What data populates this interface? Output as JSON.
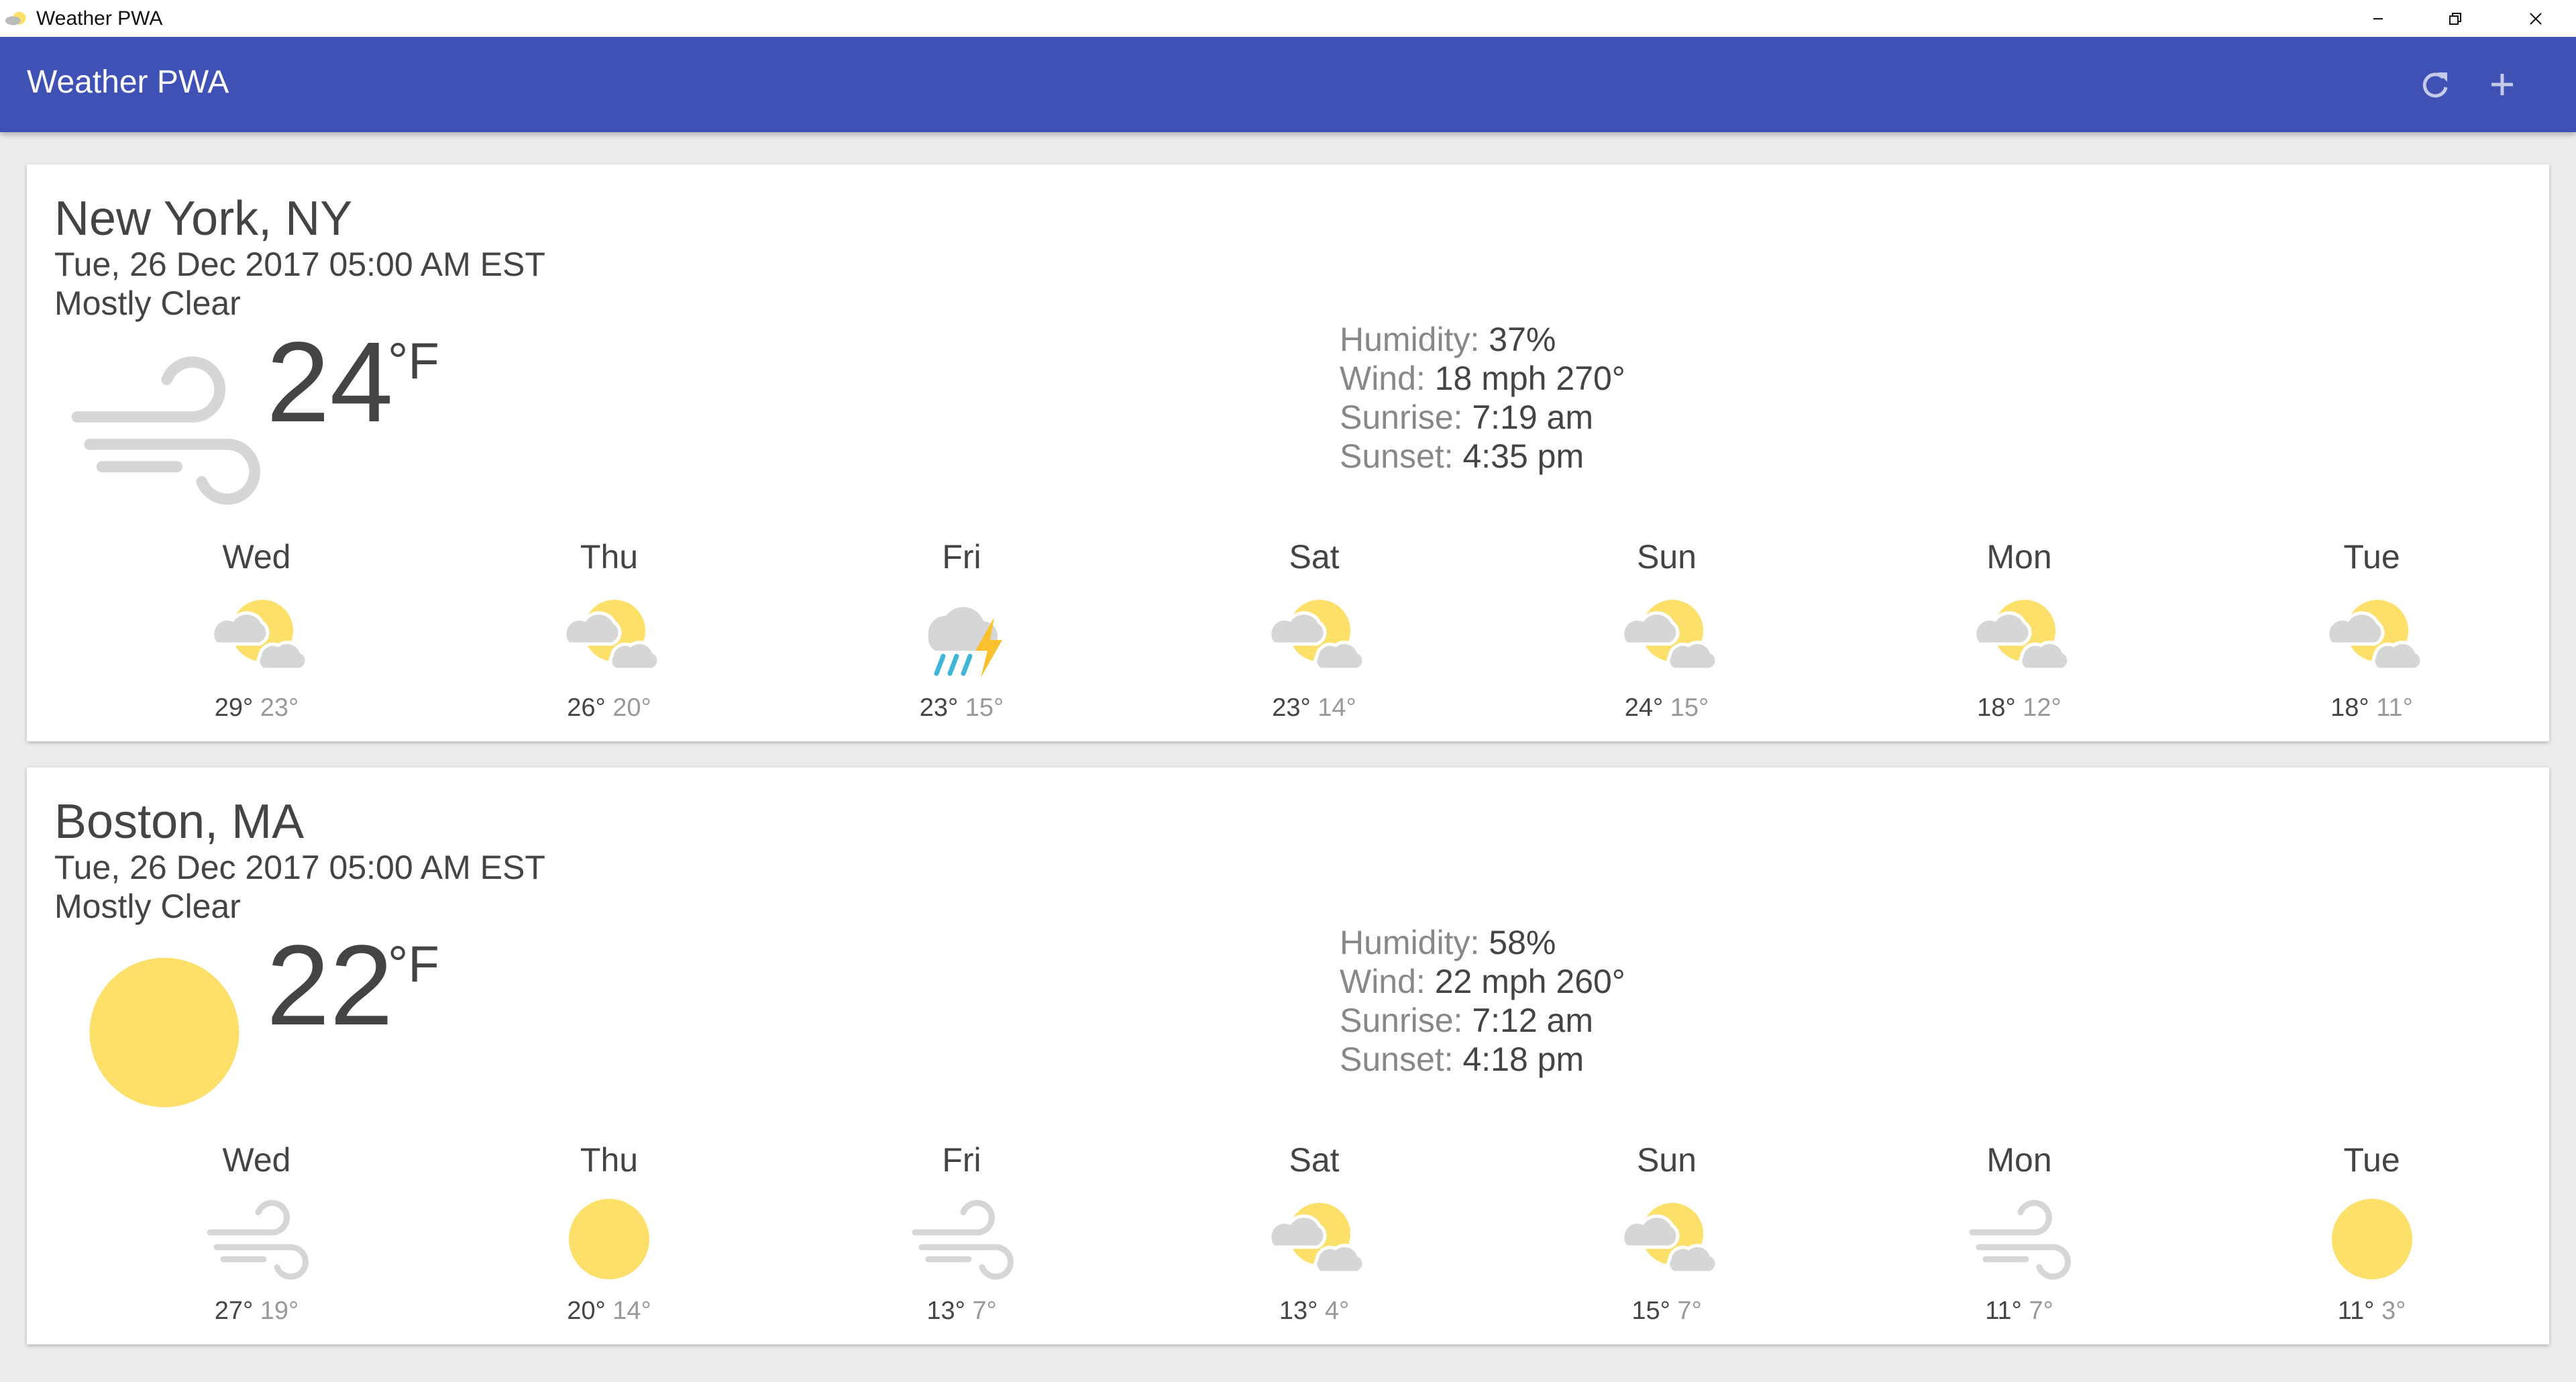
{
  "window": {
    "title": "Weather PWA",
    "controls": [
      "minimize-icon",
      "restore-icon",
      "close-icon"
    ]
  },
  "header": {
    "title": "Weather PWA",
    "refresh_icon": "refresh-icon",
    "add_icon": "add-icon",
    "color": "#3f51b5"
  },
  "colors": {
    "sun": "#fde06a",
    "cloud": "#d6d6d6",
    "wind": "#d6d6d6",
    "rain": "#3fb6d8",
    "bolt": "#fbc02d"
  },
  "cards": [
    {
      "location": "New York, NY",
      "date": "Tue, 26 Dec 2017 05:00 AM EST",
      "description": "Mostly Clear",
      "icon": "wind-icon",
      "temperature": "24",
      "scale": "°F",
      "humidity_label": "Humidity:",
      "humidity": "37%",
      "wind_label": "Wind:",
      "wind": "18 mph 270°",
      "sunrise_label": "Sunrise:",
      "sunrise": "7:19 am",
      "sunset_label": "Sunset:",
      "sunset": "4:35 pm",
      "forecast": [
        {
          "day": "Wed",
          "icon": "partly-cloudy-icon",
          "high": "29°",
          "low": "23°"
        },
        {
          "day": "Thu",
          "icon": "partly-cloudy-icon",
          "high": "26°",
          "low": "20°"
        },
        {
          "day": "Fri",
          "icon": "thunderstorm-icon",
          "high": "23°",
          "low": "15°"
        },
        {
          "day": "Sat",
          "icon": "partly-cloudy-icon",
          "high": "23°",
          "low": "14°"
        },
        {
          "day": "Sun",
          "icon": "partly-cloudy-icon",
          "high": "24°",
          "low": "15°"
        },
        {
          "day": "Mon",
          "icon": "partly-cloudy-icon",
          "high": "18°",
          "low": "12°"
        },
        {
          "day": "Tue",
          "icon": "partly-cloudy-icon",
          "high": "18°",
          "low": "11°"
        }
      ]
    },
    {
      "location": "Boston, MA",
      "date": "Tue, 26 Dec 2017 05:00 AM EST",
      "description": "Mostly Clear",
      "icon": "sun-icon",
      "temperature": "22",
      "scale": "°F",
      "humidity_label": "Humidity:",
      "humidity": "58%",
      "wind_label": "Wind:",
      "wind": "22 mph 260°",
      "sunrise_label": "Sunrise:",
      "sunrise": "7:12 am",
      "sunset_label": "Sunset:",
      "sunset": "4:18 pm",
      "forecast": [
        {
          "day": "Wed",
          "icon": "wind-icon",
          "high": "27°",
          "low": "19°"
        },
        {
          "day": "Thu",
          "icon": "sun-icon",
          "high": "20°",
          "low": "14°"
        },
        {
          "day": "Fri",
          "icon": "wind-icon",
          "high": "13°",
          "low": "7°"
        },
        {
          "day": "Sat",
          "icon": "partly-cloudy-icon",
          "high": "13°",
          "low": "4°"
        },
        {
          "day": "Sun",
          "icon": "partly-cloudy-icon",
          "high": "15°",
          "low": "7°"
        },
        {
          "day": "Mon",
          "icon": "wind-icon",
          "high": "11°",
          "low": "7°"
        },
        {
          "day": "Tue",
          "icon": "sun-icon",
          "high": "11°",
          "low": "3°"
        }
      ]
    }
  ]
}
